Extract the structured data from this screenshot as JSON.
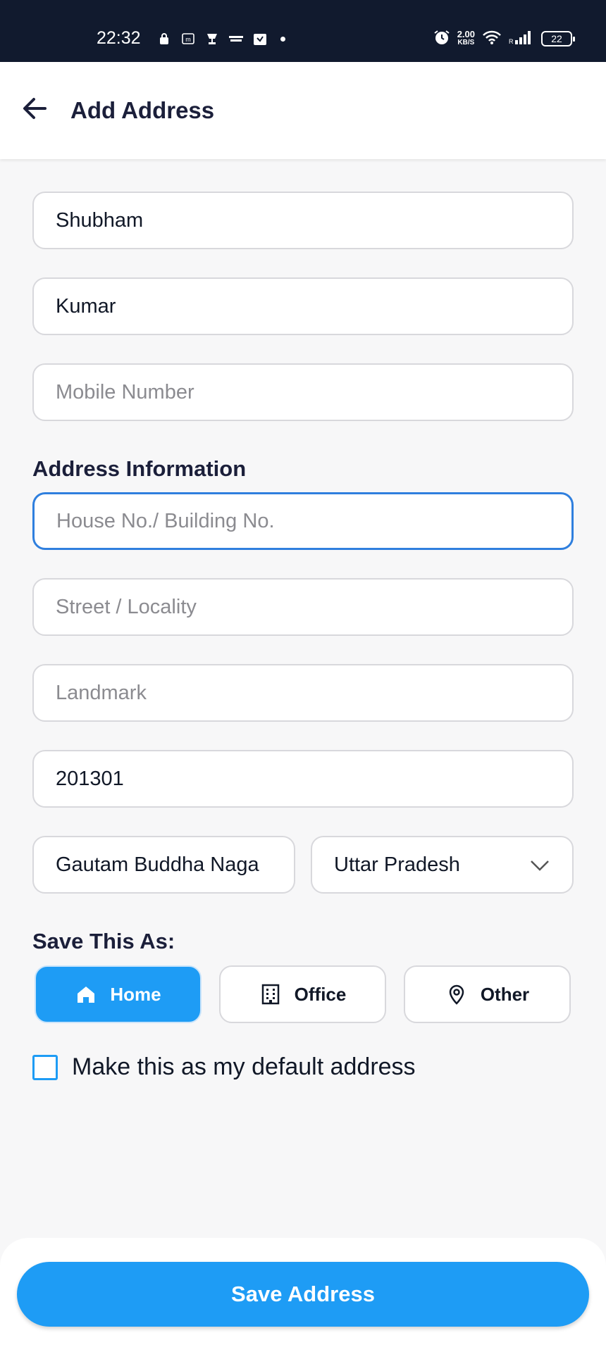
{
  "status_bar": {
    "time": "22:32",
    "net_speed_value": "2.00",
    "net_speed_unit": "KB/S",
    "battery": "22"
  },
  "header": {
    "title": "Add Address"
  },
  "form": {
    "first_name": {
      "value": "Shubham",
      "placeholder": ""
    },
    "last_name": {
      "value": "Kumar",
      "placeholder": ""
    },
    "mobile": {
      "value": "",
      "placeholder": "Mobile Number"
    },
    "address_section_label": "Address Information",
    "house": {
      "value": "",
      "placeholder": "House No./ Building No."
    },
    "street": {
      "value": "",
      "placeholder": "Street / Locality"
    },
    "landmark": {
      "value": "",
      "placeholder": "Landmark"
    },
    "pincode": {
      "value": "201301",
      "placeholder": ""
    },
    "city": "Gautam Buddha Naga",
    "state": "Uttar Pradesh"
  },
  "save_as": {
    "label": "Save This As:",
    "options": [
      {
        "label": "Home",
        "icon": "home-icon",
        "selected": true
      },
      {
        "label": "Office",
        "icon": "building-icon",
        "selected": false
      },
      {
        "label": "Other",
        "icon": "location-pin-icon",
        "selected": false
      }
    ]
  },
  "default_address": {
    "label": "Make this as my default address",
    "checked": false
  },
  "save_button": "Save Address",
  "colors": {
    "primary": "#1e9cf5",
    "focus_border": "#2f7fde",
    "status_bar": "#111a2e",
    "title": "#1b1f3a"
  }
}
